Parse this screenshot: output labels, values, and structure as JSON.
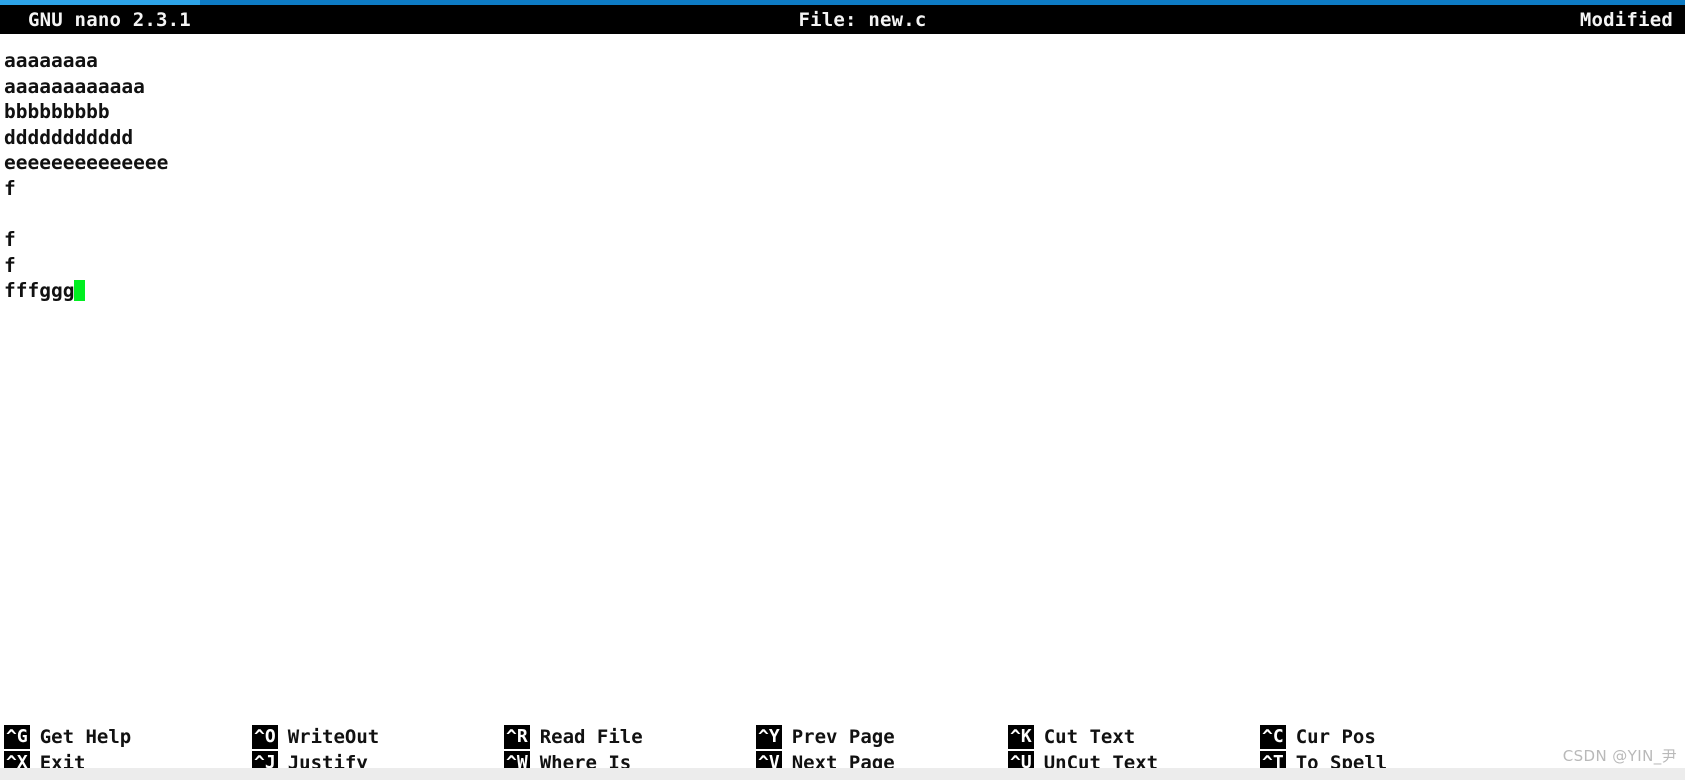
{
  "accent": {
    "primary_color": "#0d7bc4",
    "secondary_color": "#2da4e8"
  },
  "title_bar": {
    "app_name": "GNU nano 2.3.1",
    "file_label": "File: new.c",
    "status": "Modified",
    "background_color": "#000000",
    "text_color": "#f4f4f4"
  },
  "editor": {
    "background_color": "#ffffff",
    "text_color": "#111111",
    "cursor_color": "#00ef21",
    "lines": [
      "aaaaaaaa",
      "aaaaaaaaaaaa",
      "bbbbbbbbb",
      "ddddddddddd",
      "eeeeeeeeeeeeee",
      "f",
      "",
      "f",
      "f",
      "fffggg"
    ],
    "cursor_line_index": 9,
    "cursor_column": 6
  },
  "shortcuts": {
    "rows": [
      [
        {
          "key": "^G",
          "label": "Get Help"
        },
        {
          "key": "^O",
          "label": "WriteOut"
        },
        {
          "key": "^R",
          "label": "Read File"
        },
        {
          "key": "^Y",
          "label": "Prev Page"
        },
        {
          "key": "^K",
          "label": "Cut Text"
        },
        {
          "key": "^C",
          "label": "Cur Pos"
        }
      ],
      [
        {
          "key": "^X",
          "label": "Exit"
        },
        {
          "key": "^J",
          "label": "Justify"
        },
        {
          "key": "^W",
          "label": "Where Is"
        },
        {
          "key": "^V",
          "label": "Next Page"
        },
        {
          "key": "^U",
          "label": "UnCut Text"
        },
        {
          "key": "^T",
          "label": "To Spell"
        }
      ]
    ]
  },
  "watermark": {
    "text": "CSDN @YIN_尹"
  }
}
